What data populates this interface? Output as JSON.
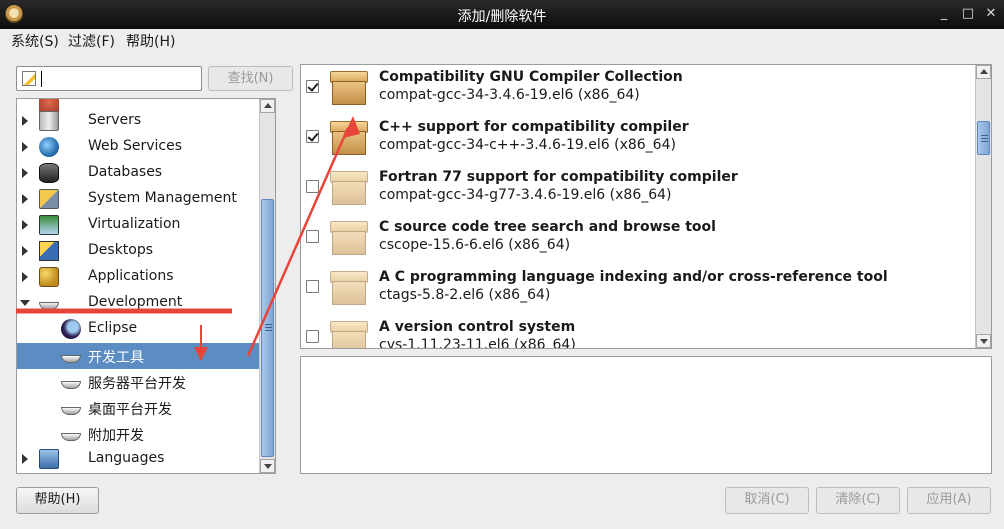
{
  "window": {
    "title": "添加/删除软件",
    "minimize_glyph": "_",
    "maximize_glyph": "□",
    "close_glyph": "✕"
  },
  "menubar": {
    "items": [
      {
        "label": "系统(S)"
      },
      {
        "label": "过滤(F)"
      },
      {
        "label": "帮助(H)"
      }
    ]
  },
  "search": {
    "value": "",
    "button_label": "查找(N)",
    "button_enabled": false
  },
  "tree": {
    "items": [
      {
        "label": "Servers",
        "icon": "servers-icon",
        "level": 0,
        "expanded": false,
        "selected": false
      },
      {
        "label": "Web Services",
        "icon": "web-services-icon",
        "level": 0,
        "expanded": false,
        "selected": false
      },
      {
        "label": "Databases",
        "icon": "databases-icon",
        "level": 0,
        "expanded": false,
        "selected": false
      },
      {
        "label": "System Management",
        "icon": "system-management-icon",
        "level": 0,
        "expanded": false,
        "selected": false
      },
      {
        "label": "Virtualization",
        "icon": "virtualization-icon",
        "level": 0,
        "expanded": false,
        "selected": false
      },
      {
        "label": "Desktops",
        "icon": "desktops-icon",
        "level": 0,
        "expanded": false,
        "selected": false
      },
      {
        "label": "Applications",
        "icon": "applications-icon",
        "level": 0,
        "expanded": false,
        "selected": false
      },
      {
        "label": "Development",
        "icon": "trowel-icon",
        "level": 0,
        "expanded": true,
        "selected": false
      },
      {
        "label": "Eclipse",
        "icon": "eclipse-icon",
        "level": 1,
        "selected": false
      },
      {
        "label": "开发工具",
        "icon": "trowel-icon",
        "level": 1,
        "selected": true
      },
      {
        "label": "服务器平台开发",
        "icon": "trowel-icon",
        "level": 1,
        "selected": false
      },
      {
        "label": "桌面平台开发",
        "icon": "trowel-icon",
        "level": 1,
        "selected": false
      },
      {
        "label": "附加开发",
        "icon": "trowel-icon",
        "level": 1,
        "selected": false
      },
      {
        "label": "Languages",
        "icon": "languages-icon",
        "level": 0,
        "expanded": false,
        "selected": false
      }
    ]
  },
  "packages": {
    "items": [
      {
        "name": "Compatibility GNU Compiler Collection",
        "version": "compat-gcc-34-3.4.6-19.el6 (x86_64)",
        "checked": true
      },
      {
        "name": "C++ support for compatibility compiler",
        "version": "compat-gcc-34-c++-3.4.6-19.el6 (x86_64)",
        "checked": true
      },
      {
        "name": "Fortran 77 support for compatibility compiler",
        "version": "compat-gcc-34-g77-3.4.6-19.el6 (x86_64)",
        "checked": false
      },
      {
        "name": "C source code tree search and browse tool",
        "version": "cscope-15.6-6.el6 (x86_64)",
        "checked": false
      },
      {
        "name": "A C programming language indexing and/or cross-reference tool",
        "version": "ctags-5.8-2.el6 (x86_64)",
        "checked": false
      },
      {
        "name": "A version control system",
        "version": "cvs-1.11.23-11.el6 (x86_64)",
        "checked": false
      }
    ]
  },
  "details": {
    "text": ""
  },
  "footer": {
    "help_label": "帮助(H)",
    "cancel_label": "取消(C)",
    "clear_label": "清除(C)",
    "apply_label": "应用(A)"
  },
  "colors": {
    "selection": "#5b8cc2",
    "annotation": "#e8443a",
    "scrollbar_thumb": "#7ea6d6"
  }
}
